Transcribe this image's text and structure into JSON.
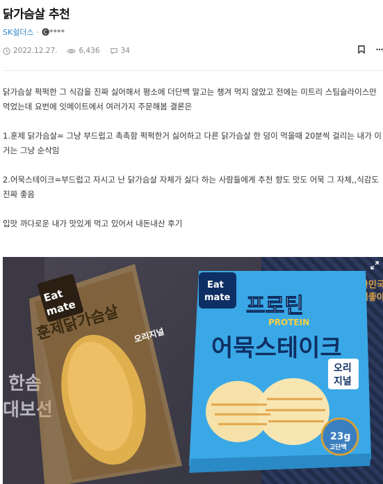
{
  "post": {
    "title": "닭가슴살 추천",
    "author": "SK쉴더스",
    "separator": "·",
    "masked_user": "🅒****",
    "date": "2022.12.27.",
    "views": "6,436",
    "comments": "34"
  },
  "body": {
    "p1_l1": "닭가슴살 퍽퍽한 그 식감을 진짜 싫어해서 평소에 더단백 말고는 챙겨 먹지 않았고 전에는 미트리 스팀슬라이스만",
    "p1_l2": "먹었는데 요번에 잇메이트에서 여러가지 주문해봄 결론은",
    "p2_l1": "1.훈제 닭가슴살= 그냥 부드럽고 촉촉함 퍽퍽한거 싫어하고 다른 닭가슴살 한 덩이 먹을때 20분씩 걸리는 내가 이",
    "p2_l2": "거는 그냥 순삭임",
    "p3_l1": "2.어묵스테이크=부드럽고 자시고 난 닭가슴살 자체가 싫다 하는 사람들에게 추천 향도 맛도 어묵 그 자체,,식감도",
    "p3_l2": "진짜 좋음",
    "p4": "입맛 까다로운 내가 맛있게 먹고 있어서 내돈내산 후기"
  },
  "photo": {
    "pkg1_brand_1": "Eat",
    "pkg1_brand_2": "mate",
    "pkg1_name": "훈제닭가슴살",
    "pkg1_flavor": "오리지널",
    "pkg2_brand_1": "Eat",
    "pkg2_brand_2": "mate",
    "pkg2_title": "프로틴",
    "pkg2_sub": "PROTEIN",
    "pkg2_name": "어묵스테이크",
    "pkg2_flavor_1": "오리",
    "pkg2_flavor_2": "지널",
    "pkg2_badge_num": "23g",
    "pkg2_badge_txt": "고단백",
    "bg_text_1": "한솜",
    "bg_text_2": "대보선",
    "bg_text_3": "대한민국",
    "bg_text_4": "농협좋아"
  },
  "colors": {
    "author": "#2d86c9",
    "pkg2_blue": "#3aa8e6",
    "pkg2_dark": "#0e2f63"
  }
}
